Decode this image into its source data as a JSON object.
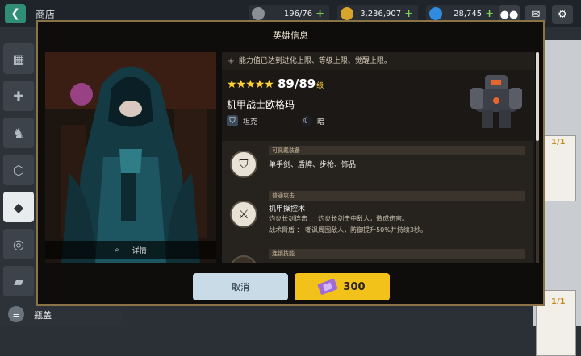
{
  "topbar": {
    "back_label": "❮",
    "title": "商店",
    "resources": [
      {
        "name": "stamina",
        "value": "196/76",
        "color": "#8a8f96"
      },
      {
        "name": "gold",
        "value": "3,236,907",
        "color": "#d7a52a"
      },
      {
        "name": "gem",
        "value": "28,745",
        "color": "#2f8be0"
      }
    ],
    "plus": "+"
  },
  "sidebar": {
    "items": [
      {
        "icon": "crate-icon",
        "glyph": "▦"
      },
      {
        "icon": "sword-icon",
        "glyph": "✚"
      },
      {
        "icon": "hero-icon",
        "glyph": "♞"
      },
      {
        "icon": "hexagon-icon",
        "glyph": "⬡"
      },
      {
        "icon": "ticket-icon",
        "glyph": "◆"
      },
      {
        "icon": "medal-icon",
        "glyph": "◎"
      },
      {
        "icon": "card-icon",
        "glyph": "▰"
      }
    ],
    "bottom_label": "瓶盖"
  },
  "background": {
    "counts": [
      "1/1",
      "1/1"
    ]
  },
  "modal": {
    "title": "英雄信息",
    "details_label": "详情",
    "notice": "能力值已达到进化上限、等级上限、觉醒上限。",
    "stars": "★★★★★",
    "level": "89/89",
    "level_unit": "级",
    "hero_name": "机甲战士欧格玛",
    "tags": [
      "坦克",
      "暗"
    ],
    "skills": [
      {
        "header": "可佩戴装备",
        "text": "单手剑、盾牌、步枪、饰品",
        "sub1": "",
        "sub2": ""
      },
      {
        "header": "普通攻击",
        "text": "机甲操控术",
        "sub1": "灼炎长剑连击 ： 灼炎长剑击中敌人，造成伤害。",
        "sub2": "战术臂盾 ： 嘲讽周围敌人，防御提升50%并持续3秒。"
      },
      {
        "header": "连锁技能",
        "text": "",
        "sub1": "",
        "sub2": ""
      }
    ],
    "cancel_label": "取消",
    "buy_price": "300"
  },
  "colors": {
    "accent_gold": "#f2c21a",
    "cancel_blue": "#c9dbe6",
    "modal_border": "#8b7348",
    "star_yellow": "#ffd23a"
  }
}
